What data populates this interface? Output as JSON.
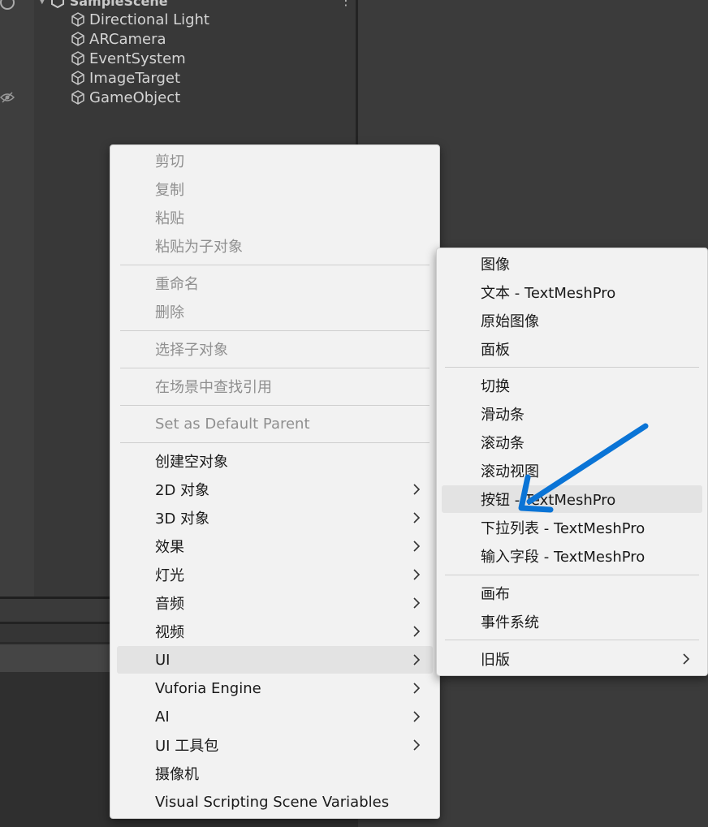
{
  "hierarchy": {
    "scene_name": "SampleScene",
    "items": [
      "Directional Light",
      "ARCamera",
      "EventSystem",
      "ImageTarget",
      "GameObject"
    ]
  },
  "context_menu": {
    "group1": [
      "剪切",
      "复制",
      "粘贴",
      "粘贴为子对象"
    ],
    "group2": [
      "重命名",
      "删除"
    ],
    "group3": [
      "选择子对象"
    ],
    "group4": [
      "在场景中查找引用"
    ],
    "group5": [
      "Set as Default Parent"
    ],
    "create_items": [
      "创建空对象",
      "2D 对象",
      "3D 对象",
      "效果",
      "灯光",
      "音频",
      "视频",
      "UI",
      "Vuforia Engine",
      "AI",
      "UI 工具包",
      "摄像机",
      "Visual Scripting Scene Variables"
    ]
  },
  "ui_submenu": {
    "group1": [
      "图像",
      "文本 - TextMeshPro",
      "原始图像",
      "面板"
    ],
    "group2": [
      "切换",
      "滑动条",
      "滚动条",
      "滚动视图",
      "按钮 - TextMeshPro",
      "下拉列表 - TextMeshPro",
      "输入字段 - TextMeshPro"
    ],
    "group3": [
      "画布",
      "事件系统"
    ],
    "group4": [
      "旧版"
    ]
  },
  "colors": {
    "menu_bg": "#f2f2f2",
    "highlight": "#e3e3e3",
    "disabled_text": "#8f8f8f",
    "annotation_arrow": "#0a74d6"
  }
}
